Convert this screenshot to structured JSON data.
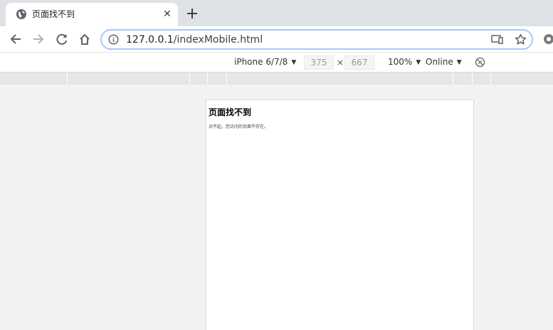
{
  "browser": {
    "tab": {
      "title": "页面找不到",
      "favicon": "globe-icon",
      "close_label": "✕"
    },
    "new_tab_icon": "plus-icon",
    "nav": {
      "back_icon": "back-arrow-icon",
      "forward_icon": "forward-arrow-icon",
      "reload_icon": "reload-icon",
      "home_icon": "home-icon"
    },
    "address": {
      "host": "127.0.0.1",
      "path": "/indexMobile.html",
      "info_icon": "info-icon",
      "cast_icon": "cast-icon",
      "bookmark_icon": "star-icon"
    },
    "extension_icon": "gear-icon"
  },
  "devtools": {
    "device_label": "iPhone 6/7/8",
    "width_value": "375",
    "height_value": "667",
    "times_sign": "×",
    "zoom_label": "100%",
    "network_label": "Online",
    "rotate_icon": "rotate-disabled-icon"
  },
  "page": {
    "heading": "页面找不到",
    "message": "对不起，您访问的页面不存在。"
  },
  "colors": {
    "tab_strip": "#dee1e6",
    "omnibox_border": "#a8c7fa",
    "ruler": "#e6e6e6",
    "canvas": "#f2f2f2"
  }
}
